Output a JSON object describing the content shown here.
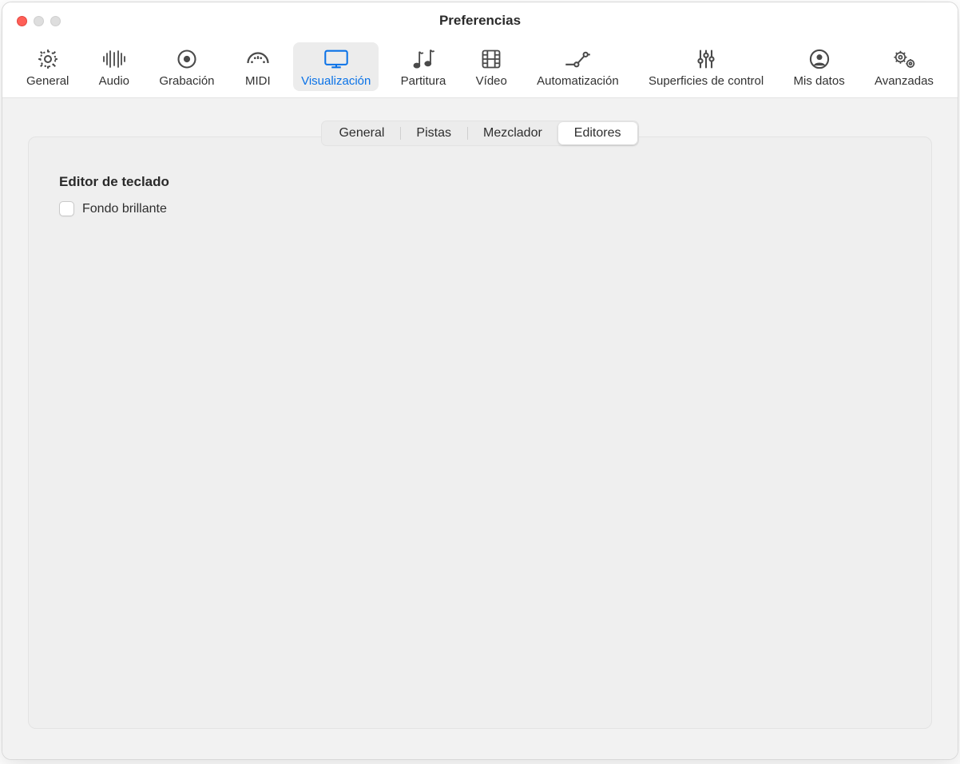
{
  "window": {
    "title": "Preferencias"
  },
  "toolbar": {
    "items": [
      {
        "id": "general",
        "label": "General"
      },
      {
        "id": "audio",
        "label": "Audio"
      },
      {
        "id": "recording",
        "label": "Grabación"
      },
      {
        "id": "midi",
        "label": "MIDI"
      },
      {
        "id": "display",
        "label": "Visualización",
        "selected": true
      },
      {
        "id": "score",
        "label": "Partitura"
      },
      {
        "id": "video",
        "label": "Vídeo"
      },
      {
        "id": "automation",
        "label": "Automatización"
      },
      {
        "id": "control-surfaces",
        "label": "Superficies de control"
      },
      {
        "id": "my-info",
        "label": "Mis datos"
      },
      {
        "id": "advanced",
        "label": "Avanzadas"
      }
    ]
  },
  "tabs": {
    "items": [
      {
        "id": "general",
        "label": "General"
      },
      {
        "id": "tracks",
        "label": "Pistas"
      },
      {
        "id": "mixer",
        "label": "Mezclador"
      },
      {
        "id": "editors",
        "label": "Editores",
        "selected": true
      }
    ]
  },
  "panel": {
    "section_title": "Editor de teclado",
    "checkbox_label": "Fondo brillante",
    "checkbox_checked": false
  }
}
